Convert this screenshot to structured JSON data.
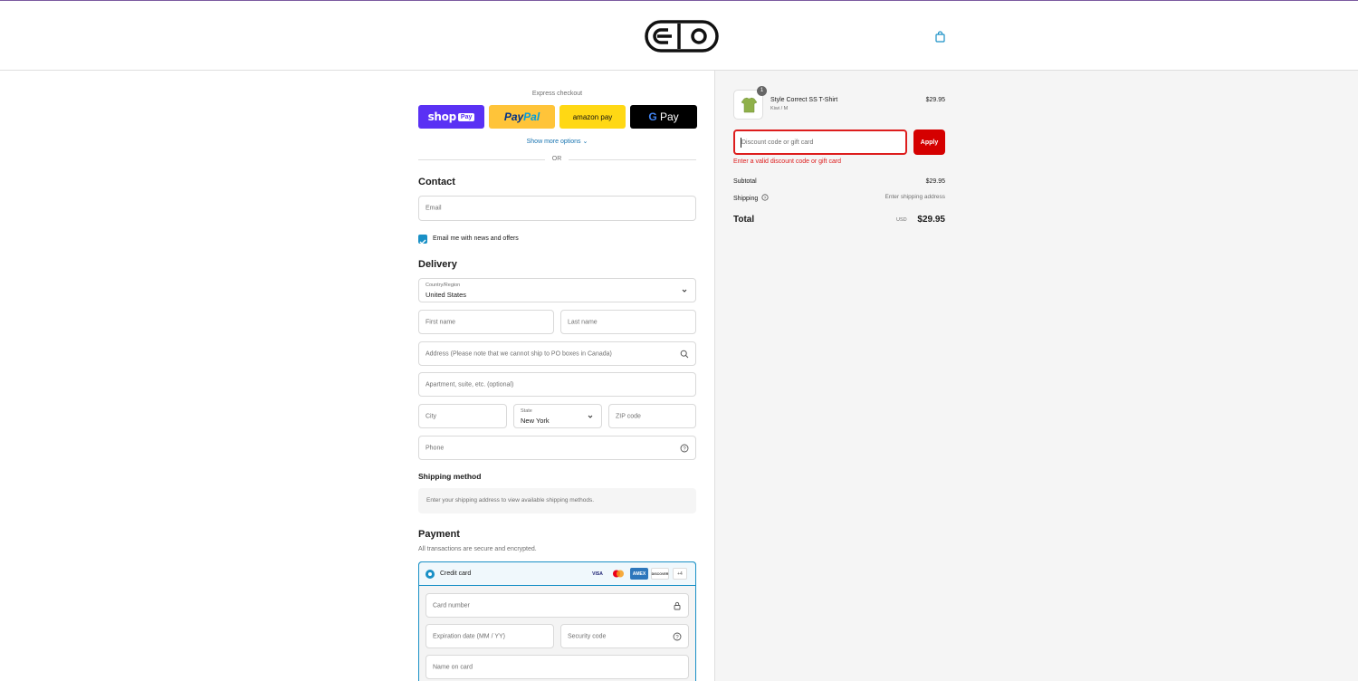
{
  "header": {
    "logo_alt": "brand-logo",
    "cart_icon": "shopping-bag-icon"
  },
  "express": {
    "title": "Express checkout",
    "shop": {
      "text": "shop",
      "badge": "Pay"
    },
    "paypal": {
      "pay": "Pay",
      "pal": "Pal"
    },
    "amazon": "amazon pay",
    "gpay": {
      "g": "G",
      "pay": " Pay"
    },
    "more_options": "Show more options ⌄",
    "or": "OR"
  },
  "contact": {
    "heading": "Contact",
    "email_placeholder": "Email",
    "newsletter_label": "Email me with news and offers",
    "newsletter_checked": true
  },
  "delivery": {
    "heading": "Delivery",
    "country_label": "Country/Region",
    "country_value": "United States",
    "first_name": "First name",
    "last_name": "Last name",
    "address": "Address (Please note that we cannot ship to PO boxes in Canada)",
    "apartment": "Apartment, suite, etc. (optional)",
    "city": "City",
    "state_label": "State",
    "state_value": "New York",
    "zip": "ZIP code",
    "phone": "Phone"
  },
  "shipping": {
    "heading": "Shipping method",
    "message": "Enter your shipping address to view available shipping methods."
  },
  "payment": {
    "heading": "Payment",
    "secure_note": "All transactions are secure and encrypted.",
    "method_label": "Credit card",
    "cards": [
      "VISA",
      "MC",
      "AMEX",
      "DISCOVER",
      "+4"
    ],
    "card_number": "Card number",
    "expiration": "Expiration date (MM / YY)",
    "security_code": "Security code",
    "name_on_card": "Name on card"
  },
  "order": {
    "quantity": "1",
    "product_name": "Style Correct SS T-Shirt",
    "variant": "Kiwi / M",
    "price": "$29.95",
    "discount_placeholder": "Discount code or gift card",
    "apply_label": "Apply",
    "discount_error": "Enter a valid discount code or gift card",
    "subtotal_label": "Subtotal",
    "subtotal_value": "$29.95",
    "shipping_label": "Shipping",
    "shipping_value": "Enter shipping address",
    "total_label": "Total",
    "currency": "USD",
    "total_value": "$29.95"
  },
  "colors": {
    "accent": "#1990c6",
    "error": "#dd1d1d",
    "apply_button": "#d50000",
    "shop_pay": "#5a31f4"
  }
}
